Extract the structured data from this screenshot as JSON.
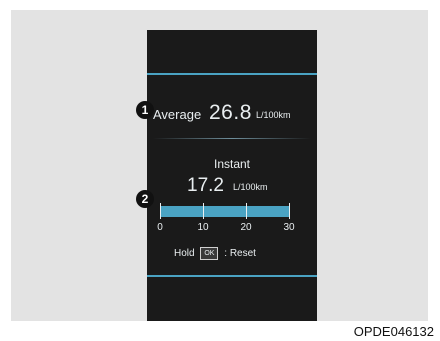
{
  "cluster": {
    "average": {
      "label": "Average",
      "value": "26.8",
      "unit": "L/100km"
    },
    "instant": {
      "label": "Instant",
      "value": "17.2",
      "unit": "L/100km"
    },
    "gauge": {
      "ticks": [
        "0",
        "10",
        "20",
        "30"
      ],
      "min": 0,
      "max": 30,
      "fill_value": 30
    },
    "reset": {
      "hold_label": "Hold",
      "key_label": "OK",
      "action_label": ": Reset"
    }
  },
  "markers": {
    "one": "1",
    "two": "2"
  },
  "caption": "OPDE046132",
  "colors": {
    "accent": "#4aa3c3",
    "screen": "#1a1a1a",
    "frame": "#e3e3e3"
  }
}
